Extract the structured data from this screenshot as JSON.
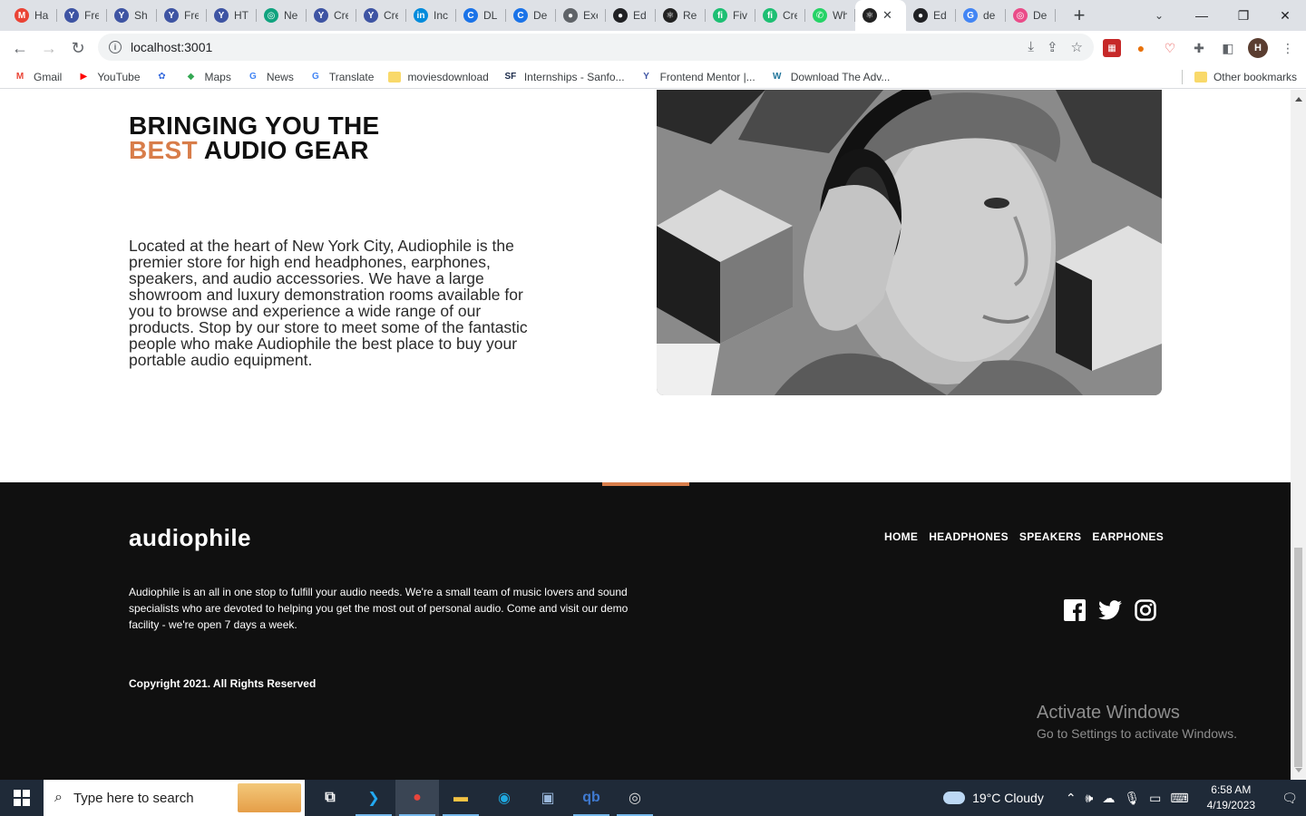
{
  "browser": {
    "tabs": [
      {
        "title": "Ha",
        "icon": "gmail-icon",
        "color": "#ea4335",
        "glyph": "M"
      },
      {
        "title": "Fre",
        "icon": "frontendmentor-icon",
        "color": "#3e54a3",
        "glyph": "Y"
      },
      {
        "title": "Sh",
        "icon": "frontendmentor-icon",
        "color": "#3e54a3",
        "glyph": "Y"
      },
      {
        "title": "Fre",
        "icon": "frontendmentor-icon",
        "color": "#3e54a3",
        "glyph": "Y"
      },
      {
        "title": "HT",
        "icon": "frontendmentor-icon",
        "color": "#3e54a3",
        "glyph": "Y"
      },
      {
        "title": "Ne",
        "icon": "chatgpt-icon",
        "color": "#10a37f",
        "glyph": "◎"
      },
      {
        "title": "Cre",
        "icon": "frontendmentor-icon",
        "color": "#3e54a3",
        "glyph": "Y"
      },
      {
        "title": "Cre",
        "icon": "frontendmentor-icon",
        "color": "#3e54a3",
        "glyph": "Y"
      },
      {
        "title": "Inc",
        "icon": "internshala-icon",
        "color": "#008bdc",
        "glyph": "in"
      },
      {
        "title": "DL",
        "icon": "c-icon",
        "color": "#1a73e8",
        "glyph": "C"
      },
      {
        "title": "De",
        "icon": "c-icon",
        "color": "#1a73e8",
        "glyph": "C"
      },
      {
        "title": "Exe",
        "icon": "globe-icon",
        "color": "#5f6368",
        "glyph": "●"
      },
      {
        "title": "Ed",
        "icon": "github-icon",
        "color": "#202124",
        "glyph": "●"
      },
      {
        "title": "Re",
        "icon": "react-icon",
        "color": "#222",
        "glyph": "⚛"
      },
      {
        "title": "Fiv",
        "icon": "fiverr-icon",
        "color": "#1dbf73",
        "glyph": "fi"
      },
      {
        "title": "Cre",
        "icon": "fiverr-icon",
        "color": "#1dbf73",
        "glyph": "fi"
      },
      {
        "title": "Wh",
        "icon": "whatsapp-icon",
        "color": "#25d366",
        "glyph": "✆"
      },
      {
        "title": "",
        "icon": "react-icon",
        "color": "#222",
        "glyph": "⚛",
        "active": true
      },
      {
        "title": "Ed",
        "icon": "github-icon",
        "color": "#202124",
        "glyph": "●"
      },
      {
        "title": "de",
        "icon": "google-icon",
        "color": "#4285f4",
        "glyph": "G"
      },
      {
        "title": "De",
        "icon": "design-icon",
        "color": "#ea4c89",
        "glyph": "◎"
      }
    ],
    "new_tab_label": "+",
    "url": "localhost:3001",
    "avatar_letter": "H",
    "bookmarks": [
      {
        "label": "Gmail",
        "icon": "gmail-icon",
        "color": "#ea4335",
        "glyph": "M"
      },
      {
        "label": "YouTube",
        "icon": "youtube-icon",
        "color": "#ff0000",
        "glyph": "▶"
      },
      {
        "label": "",
        "icon": "sync-icon",
        "color": "#3b6ede",
        "glyph": "✿"
      },
      {
        "label": "Maps",
        "icon": "maps-icon",
        "color": "#34a853",
        "glyph": "◆"
      },
      {
        "label": "News",
        "icon": "news-icon",
        "color": "#4285f4",
        "glyph": "G"
      },
      {
        "label": "Translate",
        "icon": "translate-icon",
        "color": "#4285f4",
        "glyph": "G"
      },
      {
        "label": "moviesdownload",
        "icon": "folder-icon",
        "color": "#f9d96a",
        "glyph": ""
      },
      {
        "label": "Internships - Sanfo...",
        "icon": "internship-icon",
        "color": "#1b2a4a",
        "glyph": "SF"
      },
      {
        "label": "Frontend Mentor |...",
        "icon": "frontendmentor-icon",
        "color": "#3e54a3",
        "glyph": "Y"
      },
      {
        "label": "Download The Adv...",
        "icon": "wordpress-icon",
        "color": "#21759b",
        "glyph": "W"
      }
    ],
    "other_bookmarks": "Other bookmarks"
  },
  "about": {
    "heading_line1": "BRINGING YOU THE",
    "heading_accent": "BEST",
    "heading_rest": " AUDIO GEAR",
    "body": "Located at the heart of New York City, Audiophile is the premier store for high end headphones, earphones, speakers, and audio accessories. We have a large showroom and luxury demonstration rooms available for you to browse and experience a wide range of our products. Stop by our store to meet some of the fantastic people who make Audiophile the best place to buy your portable audio equipment."
  },
  "footer": {
    "logo": "audiophile",
    "nav": [
      "HOME",
      "HEADPHONES",
      "SPEAKERS",
      "EARPHONES"
    ],
    "description": "Audiophile is an all in one stop to fulfill your audio needs. We're a small team of music lovers and sound specialists who are devoted to helping you get the most out of personal audio. Come and visit our demo facility - we're open 7 days a week.",
    "copyright": "Copyright 2021. All Rights Reserved",
    "social": [
      "facebook-icon",
      "twitter-icon",
      "instagram-icon"
    ]
  },
  "watermark": {
    "line1": "Activate Windows",
    "line2": "Go to Settings to activate Windows."
  },
  "taskbar": {
    "search_placeholder": "Type here to search",
    "apps": [
      {
        "name": "task-view-icon",
        "glyph": "⧉",
        "running": false
      },
      {
        "name": "vscode-icon",
        "glyph": "❯",
        "color": "#23a9f2",
        "running": true
      },
      {
        "name": "chrome-icon",
        "glyph": "●",
        "color": "#e8453c",
        "running": true,
        "active": true
      },
      {
        "name": "file-explorer-icon",
        "glyph": "▬",
        "color": "#f6c343",
        "running": true
      },
      {
        "name": "edge-icon",
        "glyph": "◉",
        "color": "#1fa9e0",
        "running": false
      },
      {
        "name": "control-panel-icon",
        "glyph": "▣",
        "color": "#9ab8dc",
        "running": false
      },
      {
        "name": "qbittorrent-icon",
        "glyph": "qb",
        "color": "#3f7ad1",
        "running": true
      },
      {
        "name": "obs-icon",
        "glyph": "◎",
        "color": "#ddd",
        "running": true
      }
    ],
    "weather": "19°C  Cloudy",
    "time": "6:58 AM",
    "date": "4/19/2023"
  }
}
